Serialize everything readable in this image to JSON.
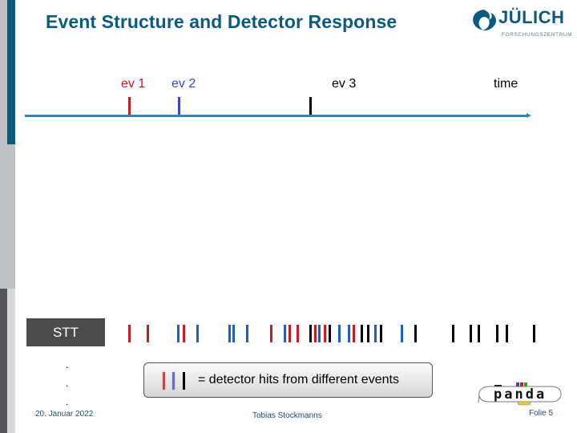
{
  "slide": {
    "title": "Event Structure and Detector Response",
    "logo": {
      "name": "JÜLICH",
      "subtitle": "FORSCHUNGSZENTRUM"
    },
    "footer": {
      "date": "20. Januar 2022",
      "author": "Tobias Stockmanns",
      "page": "Folie 5"
    },
    "colors": {
      "ev1": "#cc1b22",
      "ev2": "#3a48c0",
      "ev3": "#000000",
      "hit_blue": "#1a62c4",
      "timeline": "#1e8bc3",
      "accent": "#0b5a80"
    }
  },
  "timeline": {
    "axis_label": "time",
    "events": [
      {
        "label": "ev 1",
        "color": "#cc1b22"
      },
      {
        "label": "ev 2",
        "color": "#3a48c0"
      },
      {
        "label": "ev 3",
        "color": "#000000"
      }
    ]
  },
  "detector": {
    "label": "STT",
    "continuation": [
      ".",
      ".",
      "."
    ],
    "hits_sequence": [
      "red",
      "red",
      "blue",
      "red",
      "blue",
      "blue",
      "blue",
      "blue",
      "red",
      "blue",
      "red",
      "red",
      "black",
      "red",
      "blue",
      "red",
      "black",
      "blue",
      "blue",
      "red",
      "black",
      "black",
      "blue",
      "black",
      "blue",
      "black",
      "black",
      "black",
      "black",
      "black",
      "black",
      "black"
    ]
  },
  "legend": {
    "colors": [
      "red",
      "blue",
      "black"
    ],
    "text": "= detector hits from different events"
  },
  "experiment_logo": {
    "text": "panda"
  }
}
